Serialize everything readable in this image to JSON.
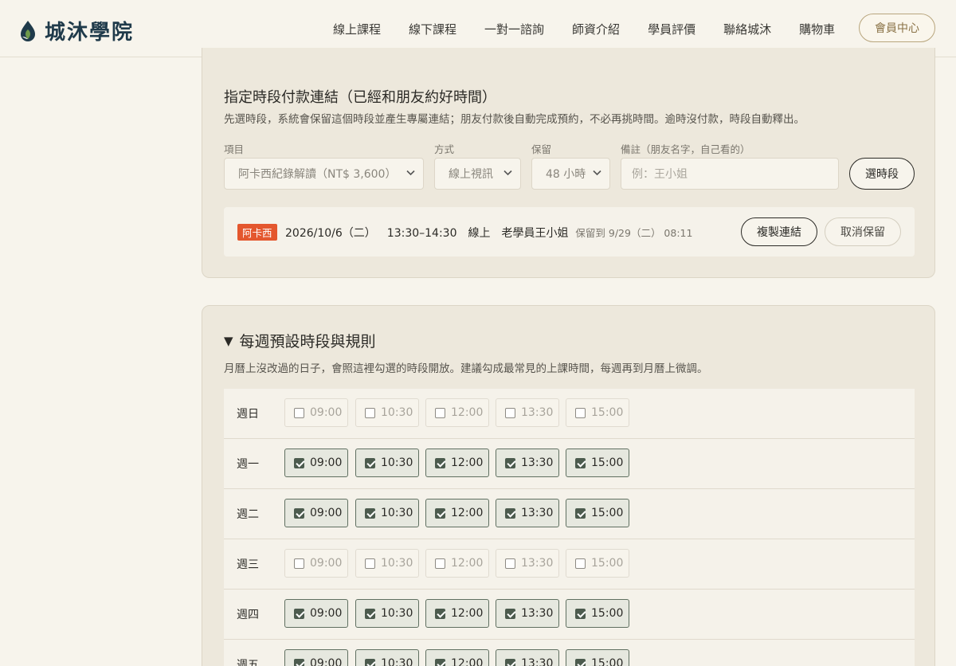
{
  "brand": {
    "name": "城沐學院",
    "logo_color": "#1f3a4a"
  },
  "nav": {
    "items": [
      "線上課程",
      "線下課程",
      "一對一諮詢",
      "師資介紹",
      "學員評價",
      "聯絡城沐",
      "購物車"
    ],
    "member_button": "會員中心"
  },
  "booking_link": {
    "title": "指定時段付款連結（已經和朋友約好時間）",
    "description": "先選時段，系統會保留這個時段並產生專屬連結；朋友付款後自動完成預約，不必再挑時間。逾時沒付款，時段自動釋出。",
    "fields": {
      "item_label": "項目",
      "item_value": "阿卡西紀錄解讀（NT$ 3,600）",
      "mode_label": "方式",
      "mode_value": "線上視訊",
      "hold_label": "保留",
      "hold_value": "48 小時",
      "note_label": "備註（朋友名字，自己看的）",
      "note_placeholder": "例：王小姐"
    },
    "pick_button": "選時段",
    "held": {
      "tag": "阿卡西",
      "date": "2026/10/6（二）",
      "time": "13:30–14:30",
      "mode": "線上",
      "note": "老學員王小姐",
      "expire": "保留到 9/29（二） 08:11",
      "copy_button": "複製連結",
      "cancel_button": "取消保留"
    }
  },
  "weekly": {
    "title": "每週預設時段與規則",
    "description": "月曆上沒改過的日子，會照這裡勾選的時段開放。建議勾成最常見的上課時間，每週再到月曆上微調。",
    "times": [
      "09:00",
      "10:30",
      "12:00",
      "13:30",
      "15:00"
    ],
    "days": [
      {
        "label": "週日",
        "checked": [
          false,
          false,
          false,
          false,
          false
        ]
      },
      {
        "label": "週一",
        "checked": [
          true,
          true,
          true,
          true,
          true
        ]
      },
      {
        "label": "週二",
        "checked": [
          true,
          true,
          true,
          true,
          true
        ]
      },
      {
        "label": "週三",
        "checked": [
          false,
          false,
          false,
          false,
          false
        ]
      },
      {
        "label": "週四",
        "checked": [
          true,
          true,
          true,
          true,
          true
        ]
      },
      {
        "label": "週五",
        "checked": [
          true,
          true,
          true,
          true,
          true
        ]
      }
    ]
  },
  "colors": {
    "background": "#f7f4ec",
    "card": "#ede8dc",
    "tag": "#e4572e",
    "checked": "#4c5b4e",
    "member_accent": "#8a7246"
  }
}
